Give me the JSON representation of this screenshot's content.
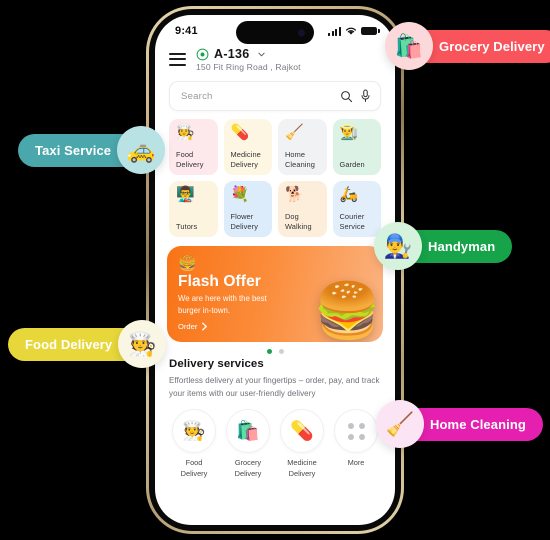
{
  "page": {
    "background": "#000000"
  },
  "phone": {
    "frame_color": "#c9b184",
    "statusbar": {
      "time": "9:41",
      "signal_icon": "signal-bars-icon",
      "wifi_icon": "wifi-icon",
      "battery_icon": "battery-icon"
    },
    "header": {
      "menu_icon": "hamburger-menu-icon",
      "location_pin_icon": "location-pin-icon",
      "location_code": "A-136",
      "chevron_icon": "chevron-down-icon",
      "address": "150 Fit Ring Road , Rajkot"
    },
    "search": {
      "placeholder": "Search",
      "search_icon": "search-icon",
      "mic_icon": "microphone-icon"
    },
    "categories": [
      {
        "label": "Food\nDelivery",
        "label_l1": "Food",
        "label_l2": "Delivery",
        "icon": "🧑‍🍳",
        "icon_name": "food-delivery-icon",
        "bg": "#fde8ec"
      },
      {
        "label": "Medicine Delivery",
        "label_l1": "Medicine",
        "label_l2": "Delivery",
        "icon": "💊",
        "icon_name": "medicine-delivery-icon",
        "bg": "#fdf6e3"
      },
      {
        "label": "Home Cleaning",
        "label_l1": "Home",
        "label_l2": "Cleaning",
        "icon": "🧹",
        "icon_name": "home-cleaning-icon",
        "bg": "#f1f2f4"
      },
      {
        "label": "Garden",
        "label_l1": "Garden",
        "label_l2": "",
        "icon": "👨‍🌾",
        "icon_name": "garden-icon",
        "bg": "#dcf2e4"
      },
      {
        "label": "Tutors",
        "label_l1": "Tutors",
        "label_l2": "",
        "icon": "👨‍🏫",
        "icon_name": "tutors-icon",
        "bg": "#fdf4df"
      },
      {
        "label": "Flower Delivery",
        "label_l1": "Flower",
        "label_l2": "Delivery",
        "icon": "💐",
        "icon_name": "flower-delivery-icon",
        "bg": "#dcecfa"
      },
      {
        "label": "Dog Walking",
        "label_l1": "Dog",
        "label_l2": "Walking",
        "icon": "🐕",
        "icon_name": "dog-walking-icon",
        "bg": "#fdeedb"
      },
      {
        "label": "Courier Service",
        "label_l1": "Courier",
        "label_l2": "Service",
        "icon": "🛵",
        "icon_name": "courier-service-icon",
        "bg": "#e3eefb"
      }
    ],
    "banner": {
      "badge_icon": "🍔",
      "badge_icon_name": "burger-badge-icon",
      "title": "Flash Offer",
      "subtitle": "We are here with the best burger in-town.",
      "cta": "Order",
      "cta_arrow_icon": "chevron-right-icon",
      "image_icon": "🍔",
      "image_icon_name": "burger-stack-image",
      "gradient_from": "#f97316",
      "gradient_to": "#fbb482",
      "dots": [
        {
          "active": true,
          "color": "#16a34a"
        },
        {
          "active": false,
          "color": "#cfcfd4"
        }
      ]
    },
    "delivery_services": {
      "heading": "Delivery services",
      "description": "Effortless delivery at your fingertips – order, pay, and track your items with our user-friendly delivery",
      "items": [
        {
          "label_l1": "Food",
          "label_l2": "Delivery",
          "icon": "🧑‍🍳",
          "icon_name": "food-delivery-icon"
        },
        {
          "label_l1": "Grocery",
          "label_l2": "Delivery",
          "icon": "🛍️",
          "icon_name": "grocery-delivery-icon"
        },
        {
          "label_l1": "Medicine",
          "label_l2": "Delivery",
          "icon": "💊",
          "icon_name": "medicine-delivery-icon"
        },
        {
          "label_l1": "More",
          "label_l2": "",
          "icon": "grid-dots",
          "icon_name": "more-dots-icon"
        }
      ]
    }
  },
  "floating_badges": [
    {
      "label": "Grocery Delivery",
      "icon": "🛍️",
      "icon_name": "grocery-bag-icon",
      "pill_color": "#f9545b",
      "circle_color": "#fbd9da"
    },
    {
      "label": "Taxi Service",
      "icon": "🚕",
      "icon_name": "taxi-icon",
      "pill_color": "#4aa7ac",
      "circle_color": "#b9e2e4"
    },
    {
      "label": "Handyman",
      "icon": "👨‍🔧",
      "icon_name": "handyman-icon",
      "pill_color": "#16a34a",
      "circle_color": "#d5f2dd"
    },
    {
      "label": "Food Delivery",
      "icon": "🧑‍🍳",
      "icon_name": "food-courier-icon",
      "pill_color": "#e8d73a",
      "circle_color": "#faf6e4"
    },
    {
      "label": "Home Cleaning",
      "icon": "🧹",
      "icon_name": "home-cleaning-icon",
      "pill_color": "#e520b0",
      "circle_color": "#fbe4f4"
    }
  ]
}
